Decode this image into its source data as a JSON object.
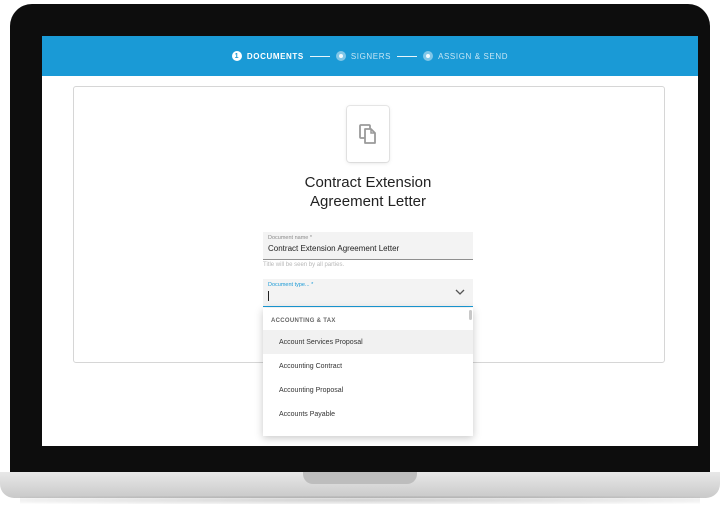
{
  "stepper": {
    "steps": [
      {
        "num": "1",
        "label": "DOCUMENTS"
      },
      {
        "label": "SIGNERS"
      },
      {
        "label": "ASSIGN & SEND"
      }
    ]
  },
  "document": {
    "title_line1": "Contract Extension",
    "title_line2": "Agreement Letter"
  },
  "name_field": {
    "label": "Document name *",
    "value": "Contract Extension Agreement Letter",
    "helper": "Title will be seen by all parties."
  },
  "type_field": {
    "label": "Document type... *",
    "value": ""
  },
  "dropdown": {
    "group": "ACCOUNTING & TAX",
    "items": [
      "Account Services Proposal",
      "Accounting Contract",
      "Accounting Proposal",
      "Accounts Payable"
    ]
  },
  "colors": {
    "accent": "#1a9ad6",
    "bezel": "#0d0d0d"
  }
}
